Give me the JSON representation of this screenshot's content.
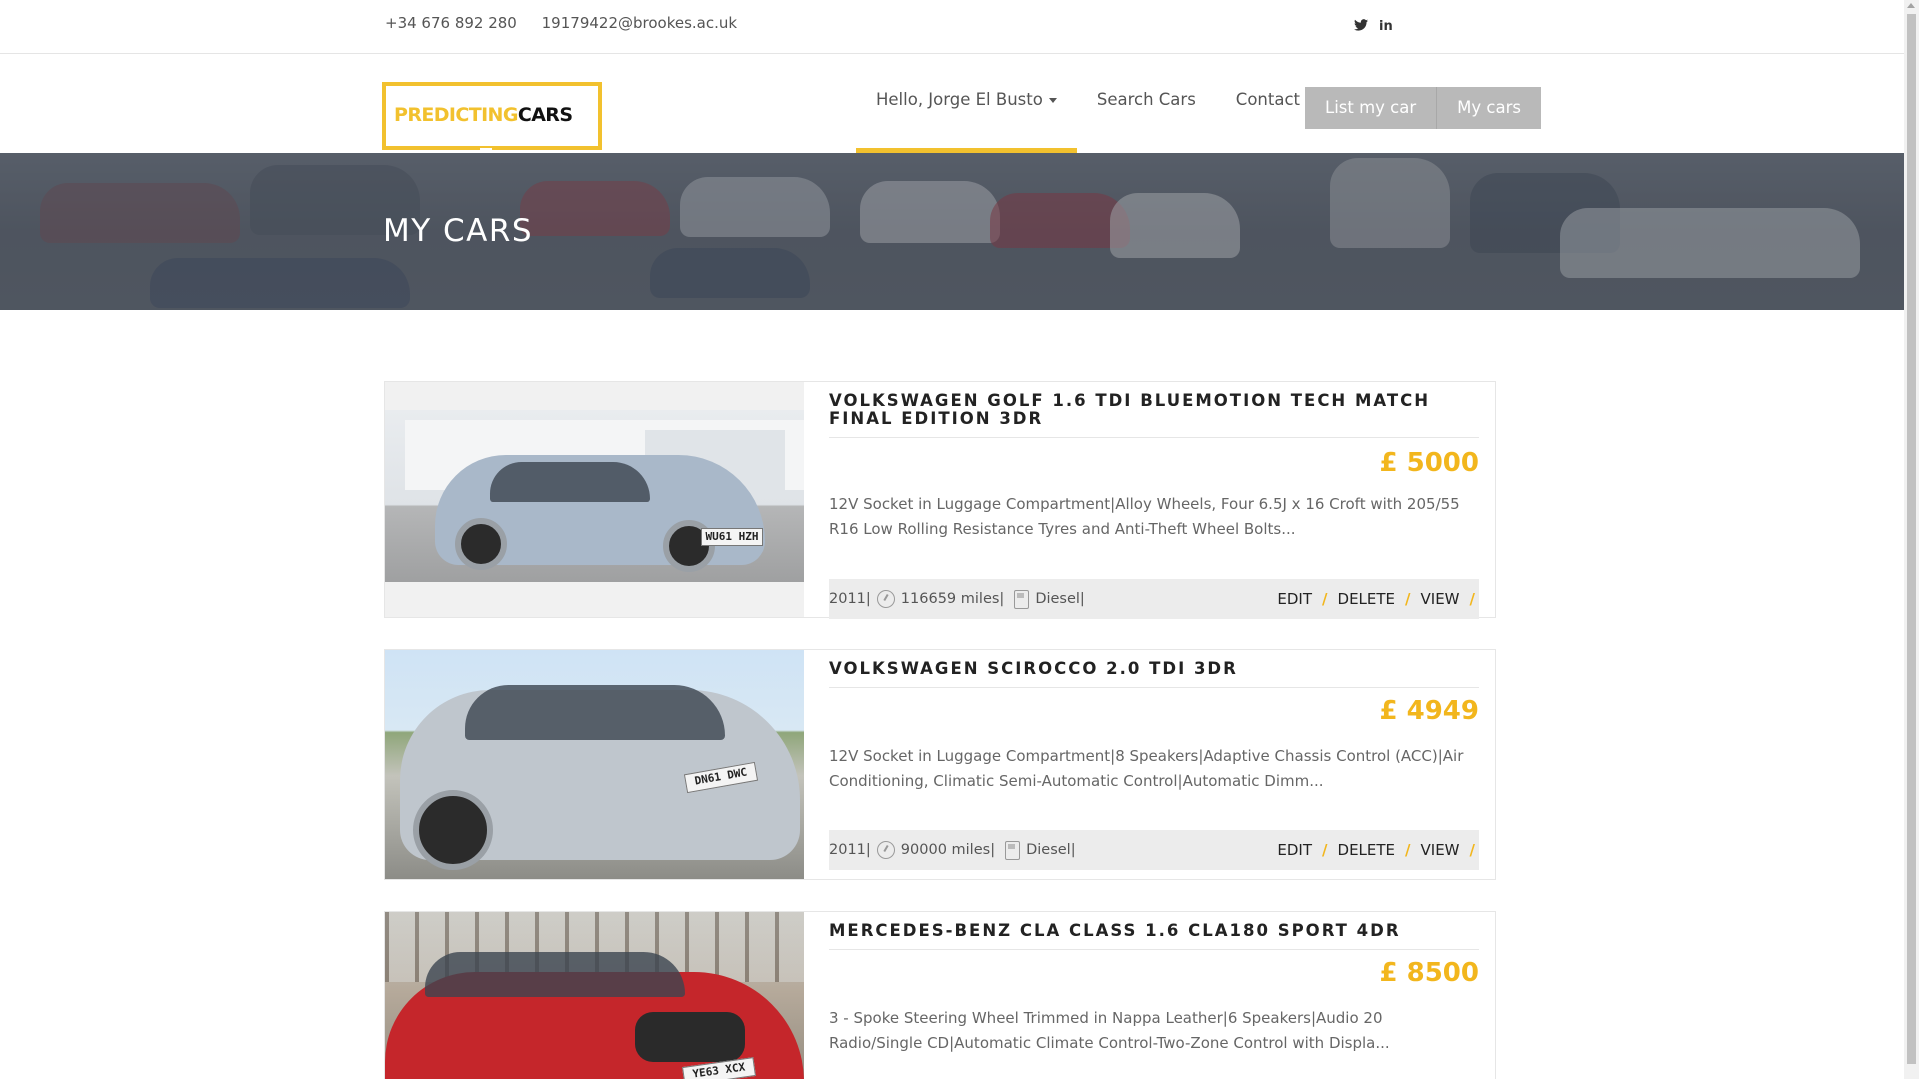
{
  "topbar": {
    "phone": "+34 676 892 280",
    "email": "19179422@brookes.ac.uk",
    "social": [
      {
        "icon": "twitter-icon",
        "glyph": "❧"
      },
      {
        "icon": "linkedin-icon",
        "glyph": "in"
      }
    ]
  },
  "nav": {
    "logo_part1": "PREDICTING",
    "logo_part2": "CARS",
    "menu": [
      "Hello, Jorge El Busto",
      "Search Cars",
      "Contact"
    ],
    "buttons": [
      "List my car",
      "My cars"
    ]
  },
  "hero": {
    "title": "MY CARS"
  },
  "listings": [
    {
      "title": "VOLKSWAGEN GOLF 1.6 TDI BLUEMOTION TECH MATCH FINAL EDITION 3DR",
      "price": "£ 5000",
      "description": "12V Socket in Luggage Compartment|Alloy Wheels, Four 6.5J x 16 Croft with 205/55 R16 Low Rolling Resistance Tyres and Anti-Theft Wheel Bolts...",
      "year": "2011|",
      "mileage": "116659 miles|",
      "fuel": "Diesel|",
      "plate": "WU61 HZH",
      "color": "#a9b8c9"
    },
    {
      "title": "VOLKSWAGEN SCIROCCO 2.0 TDI 3DR",
      "price": "£ 4949",
      "description": "12V Socket in Luggage Compartment|8 Speakers|Adaptive Chassis Control (ACC)|Air Conditioning, Climatic Semi-Automatic Control|Automatic Dimm...",
      "year": "2011|",
      "mileage": "90000 miles|",
      "fuel": "Diesel|",
      "plate": "DN61 DWC",
      "color": "#bfc6cd"
    },
    {
      "title": "MERCEDES-BENZ CLA CLASS 1.6 CLA180 SPORT 4DR",
      "price": "£ 8500",
      "description": "3 - Spoke Steering Wheel Trimmed in Nappa Leather|6 Speakers|Audio 20 Radio/Single CD|Automatic Climate Control-Two-Zone Control with Displa...",
      "plate": "YE63 XCX",
      "color": "#c5262b"
    }
  ],
  "actions": {
    "edit": "EDIT",
    "delete": "DELETE",
    "view": "VIEW",
    "separator": "/"
  }
}
